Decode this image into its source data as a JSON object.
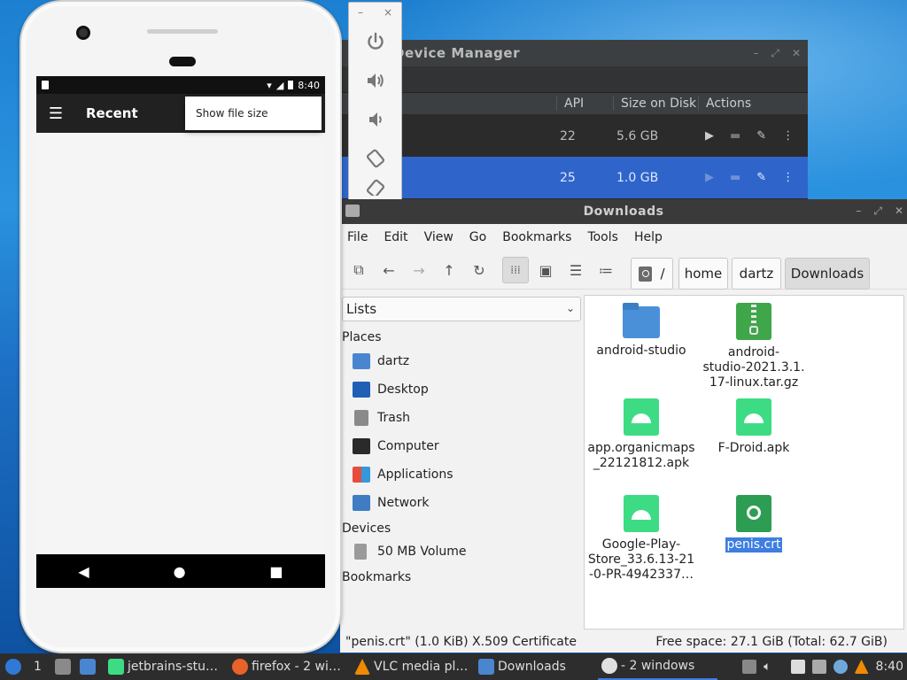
{
  "device_manager": {
    "title": "Device Manager",
    "columns": [
      "API",
      "Size on Disk",
      "Actions"
    ],
    "rows": [
      {
        "api": "22",
        "size": "5.6 GB",
        "selected": false
      },
      {
        "api": "25",
        "size": "1.0 GB",
        "selected": true
      }
    ],
    "action_icons": [
      "play-icon",
      "folder-icon",
      "edit-icon",
      "more-icon"
    ]
  },
  "emulator_toolbar": {
    "window_controls": [
      "–",
      "×"
    ],
    "buttons": [
      "power-icon",
      "volume-up-icon",
      "volume-down-icon",
      "rotate-left-icon",
      "rotate-right-icon"
    ]
  },
  "file_manager": {
    "title": "Downloads",
    "menu": [
      "File",
      "Edit",
      "View",
      "Go",
      "Bookmarks",
      "Tools",
      "Help"
    ],
    "breadcrumbs": [
      "/",
      "home",
      "dartz",
      "Downloads"
    ],
    "side_panel_select": "Lists",
    "places_heading": "Places",
    "places": [
      "dartz",
      "Desktop",
      "Trash",
      "Computer",
      "Applications",
      "Network"
    ],
    "devices_heading": "Devices",
    "devices": [
      "50 MB Volume"
    ],
    "bookmarks_heading": "Bookmarks",
    "files": [
      {
        "name": "android-studio",
        "type": "folder"
      },
      {
        "name": "android-studio-2021.3.1.17-linux.tar.gz",
        "lines": [
          "android-",
          "studio-2021.3.1.",
          "17-linux.tar.gz"
        ],
        "type": "archive"
      },
      {
        "name": "app.organicmaps_22121812.apk",
        "lines": [
          "app.organicmaps",
          "_22121812.apk"
        ],
        "type": "apk"
      },
      {
        "name": "F-Droid.apk",
        "type": "apk"
      },
      {
        "name": "Google-Play-Store_33.6.13-21-0-PR-4942337...",
        "lines": [
          "Google-Play-",
          "Store_33.6.13-21",
          "-0-PR-4942337…"
        ],
        "type": "apk"
      },
      {
        "name": "penis.crt",
        "type": "certificate",
        "selected": true
      }
    ],
    "status_left": "\"penis.crt\" (1.0 KiB) X.509 Certificate",
    "status_right": "Free space: 27.1 GiB (Total: 62.7 GiB)"
  },
  "phone": {
    "status_time": "8:40",
    "app_title": "Recent",
    "menu_popup_item": "Show file size"
  },
  "taskbar": {
    "workspace": "1",
    "tasks": [
      {
        "label": "jetbrains-stu…",
        "icon": "android-icon"
      },
      {
        "label": "firefox - 2 wi…",
        "icon": "firefox-icon"
      },
      {
        "label": "VLC media pl…",
        "icon": "vlc-icon"
      },
      {
        "label": "Downloads",
        "icon": "folder-icon"
      },
      {
        "label": "- 2 windows",
        "icon": "emulator-icon",
        "active": true
      }
    ],
    "clock": "8:40"
  }
}
